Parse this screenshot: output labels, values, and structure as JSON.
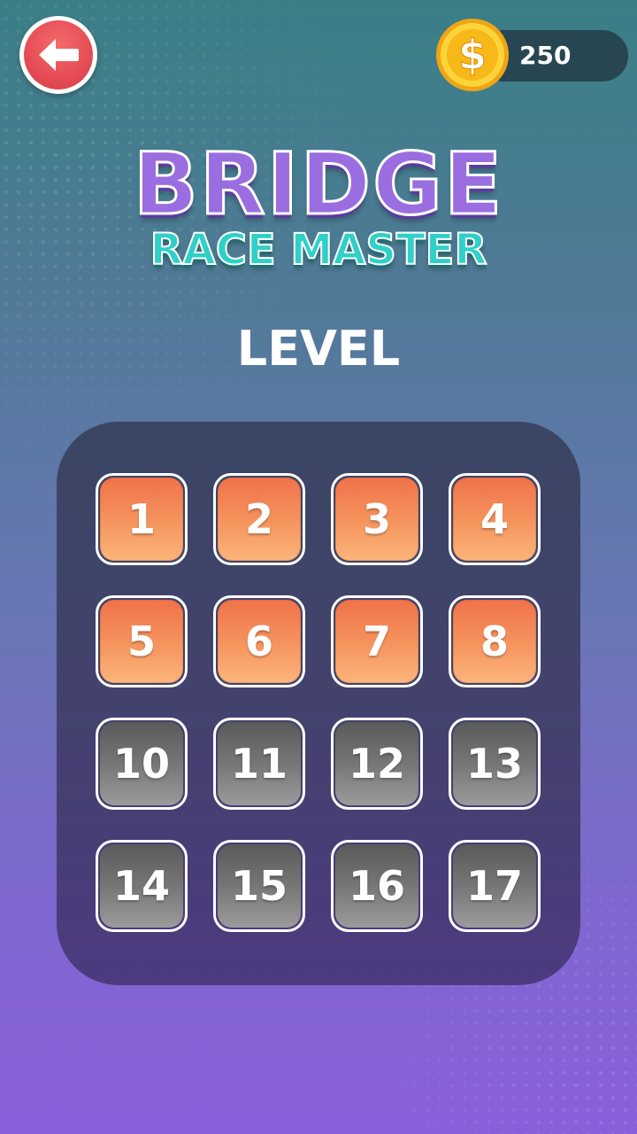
{
  "header": {
    "back_icon": "arrow-left-icon",
    "coin_icon": "dollar-coin-icon",
    "coins": "250"
  },
  "title": {
    "main": "BRIDGE",
    "sub": "RACE MASTER"
  },
  "level_heading": "LEVEL",
  "levels": [
    {
      "label": "1",
      "state": "unlocked"
    },
    {
      "label": "2",
      "state": "unlocked"
    },
    {
      "label": "3",
      "state": "unlocked"
    },
    {
      "label": "4",
      "state": "unlocked"
    },
    {
      "label": "5",
      "state": "unlocked"
    },
    {
      "label": "6",
      "state": "unlocked"
    },
    {
      "label": "7",
      "state": "unlocked"
    },
    {
      "label": "8",
      "state": "unlocked"
    },
    {
      "label": "10",
      "state": "locked"
    },
    {
      "label": "11",
      "state": "locked"
    },
    {
      "label": "12",
      "state": "locked"
    },
    {
      "label": "13",
      "state": "locked"
    },
    {
      "label": "14",
      "state": "locked"
    },
    {
      "label": "15",
      "state": "locked"
    },
    {
      "label": "16",
      "state": "locked"
    },
    {
      "label": "17",
      "state": "locked"
    }
  ],
  "colors": {
    "unlocked": "#f5925c",
    "locked": "#767676",
    "back_button": "#e54c55",
    "coin": "#f7b81a"
  }
}
